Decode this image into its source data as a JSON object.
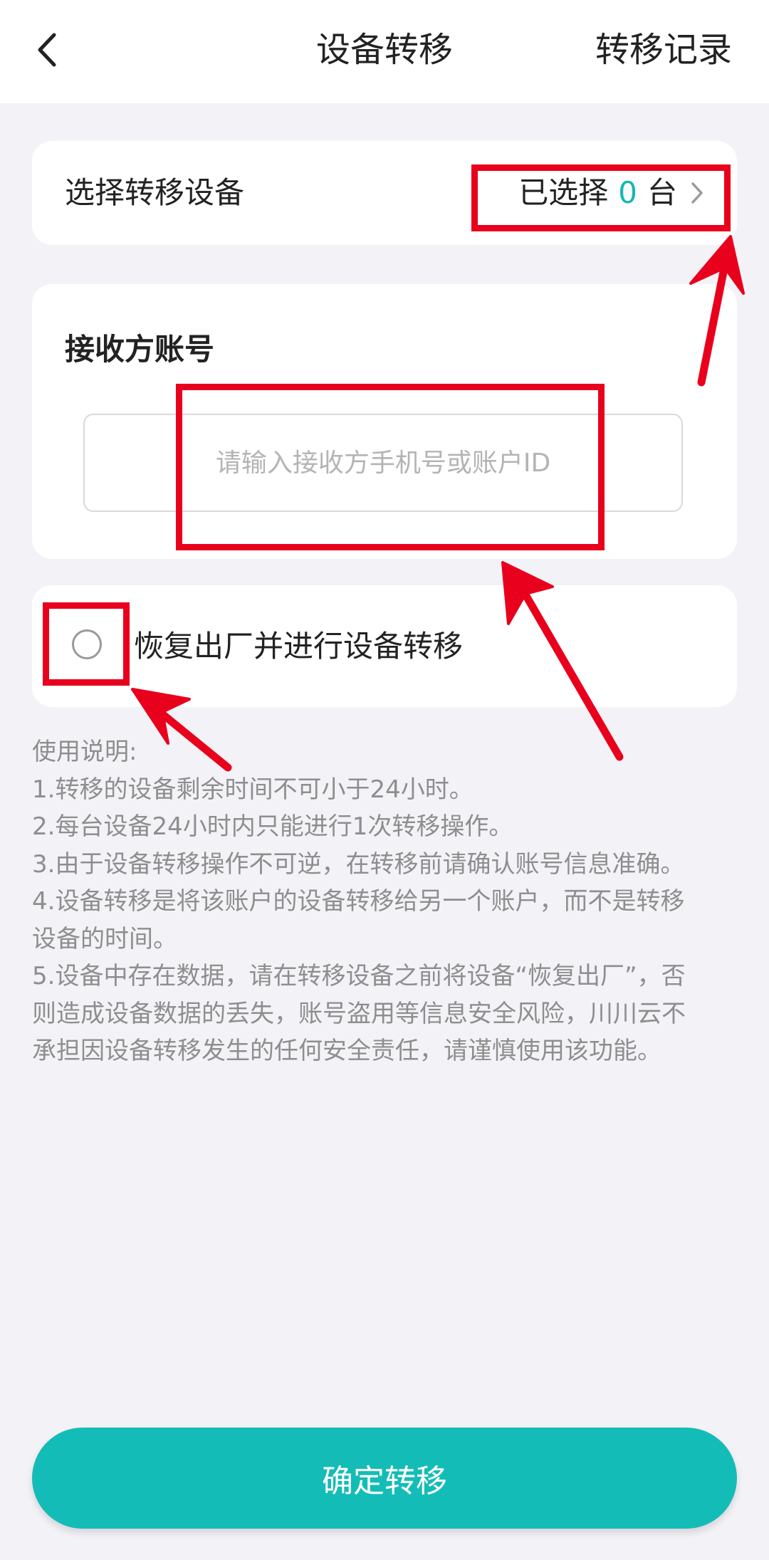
{
  "header": {
    "title": "设备转移",
    "records_label": "转移记录"
  },
  "select_device": {
    "label": "选择转移设备",
    "value_prefix": "已选择",
    "count": "0",
    "value_suffix": "台"
  },
  "receiver": {
    "label": "接收方账号",
    "placeholder": "请输入接收方手机号或账户ID",
    "value": ""
  },
  "factory_reset": {
    "label": "恢复出厂并进行设备转移",
    "checked": false
  },
  "notes": {
    "lines": [
      "使用说明:",
      "1.转移的设备剩余时间不可小于24小时。",
      "2.每台设备24小时内只能进行1次转移操作。",
      "3.由于设备转移操作不可逆，在转移前请确认账号信息准确。",
      "4.设备转移是将该账户的设备转移给另一个账户，而不是转移",
      "设备的时间。",
      "5.设备中存在数据，请在转移设备之前将设备“恢复出厂”，否",
      "则造成设备数据的丢失，账号盗用等信息安全风险，川川云不",
      "承担因设备转移发生的任何安全责任，请谨慎使用该功能。"
    ]
  },
  "confirm_button": {
    "label": "确定转移"
  },
  "colors": {
    "accent": "#14bcb7",
    "annotation": "#e8001c",
    "background": "#f3f2f7"
  },
  "icons": {
    "back": "chevron-left-icon",
    "select_arrow": "chevron-right-icon",
    "radio": "radio-unchecked-icon"
  }
}
